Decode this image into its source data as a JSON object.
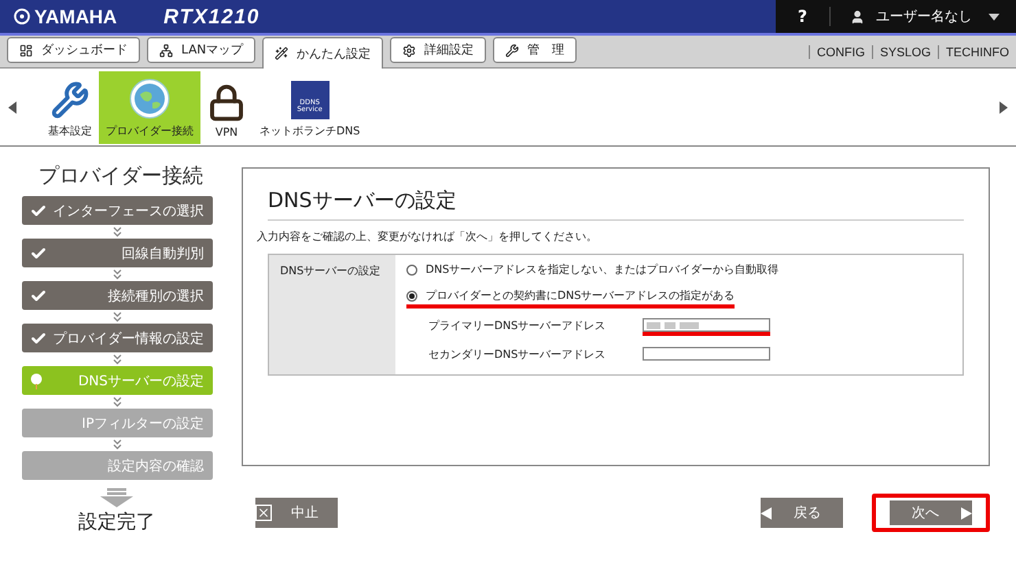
{
  "header": {
    "brand": "YAMAHA",
    "model": "RTX1210",
    "help": "?",
    "user": "ユーザー名なし"
  },
  "tabs": [
    {
      "label": "ダッシュボード",
      "selected": false
    },
    {
      "label": "LANマップ",
      "selected": false
    },
    {
      "label": "かんたん設定",
      "selected": true
    },
    {
      "label": "詳細設定",
      "selected": false
    },
    {
      "label": "管　理",
      "selected": false
    }
  ],
  "links": [
    "CONFIG",
    "SYSLOG",
    "TECHINFO"
  ],
  "wizards": [
    {
      "label": "基本設定",
      "selected": false
    },
    {
      "label": "プロバイダー接続",
      "selected": true
    },
    {
      "label": "VPN",
      "selected": false
    },
    {
      "label": "ネットボランチDNS",
      "badge": "DDNS Service",
      "selected": false
    }
  ],
  "sidebar": {
    "title": "プロバイダー接続",
    "steps": [
      {
        "label": "インターフェースの選択",
        "kind": "done"
      },
      {
        "label": "回線自動判別",
        "kind": "done"
      },
      {
        "label": "接続種別の選択",
        "kind": "done"
      },
      {
        "label": "プロバイダー情報の設定",
        "kind": "done"
      },
      {
        "label": "DNSサーバーの設定",
        "kind": "current"
      },
      {
        "label": "IPフィルターの設定",
        "kind": "pending"
      },
      {
        "label": "設定内容の確認",
        "kind": "pending"
      }
    ],
    "final": "設定完了"
  },
  "panel": {
    "title": "DNSサーバーの設定",
    "description": "入力内容をご確認の上、変更がなければ「次へ」を押してください。",
    "row_label": "DNSサーバーの設定",
    "options": [
      {
        "label": "DNSサーバーアドレスを指定しない、またはプロバイダーから自動取得",
        "selected": false,
        "highlighted": false
      },
      {
        "label": "プロバイダーとの契約書にDNSサーバーアドレスの指定がある",
        "selected": true,
        "highlighted": true
      }
    ],
    "fields": [
      {
        "label": "プライマリーDNSサーバーアドレス",
        "masked": true,
        "highlighted": true
      },
      {
        "label": "セカンダリーDNSサーバーアドレス",
        "masked": false,
        "highlighted": false
      }
    ]
  },
  "buttons": {
    "cancel": {
      "label": "中止",
      "highlighted": false
    },
    "back": {
      "label": "戻る",
      "highlighted": false
    },
    "next": {
      "label": "次へ",
      "highlighted": true
    }
  }
}
